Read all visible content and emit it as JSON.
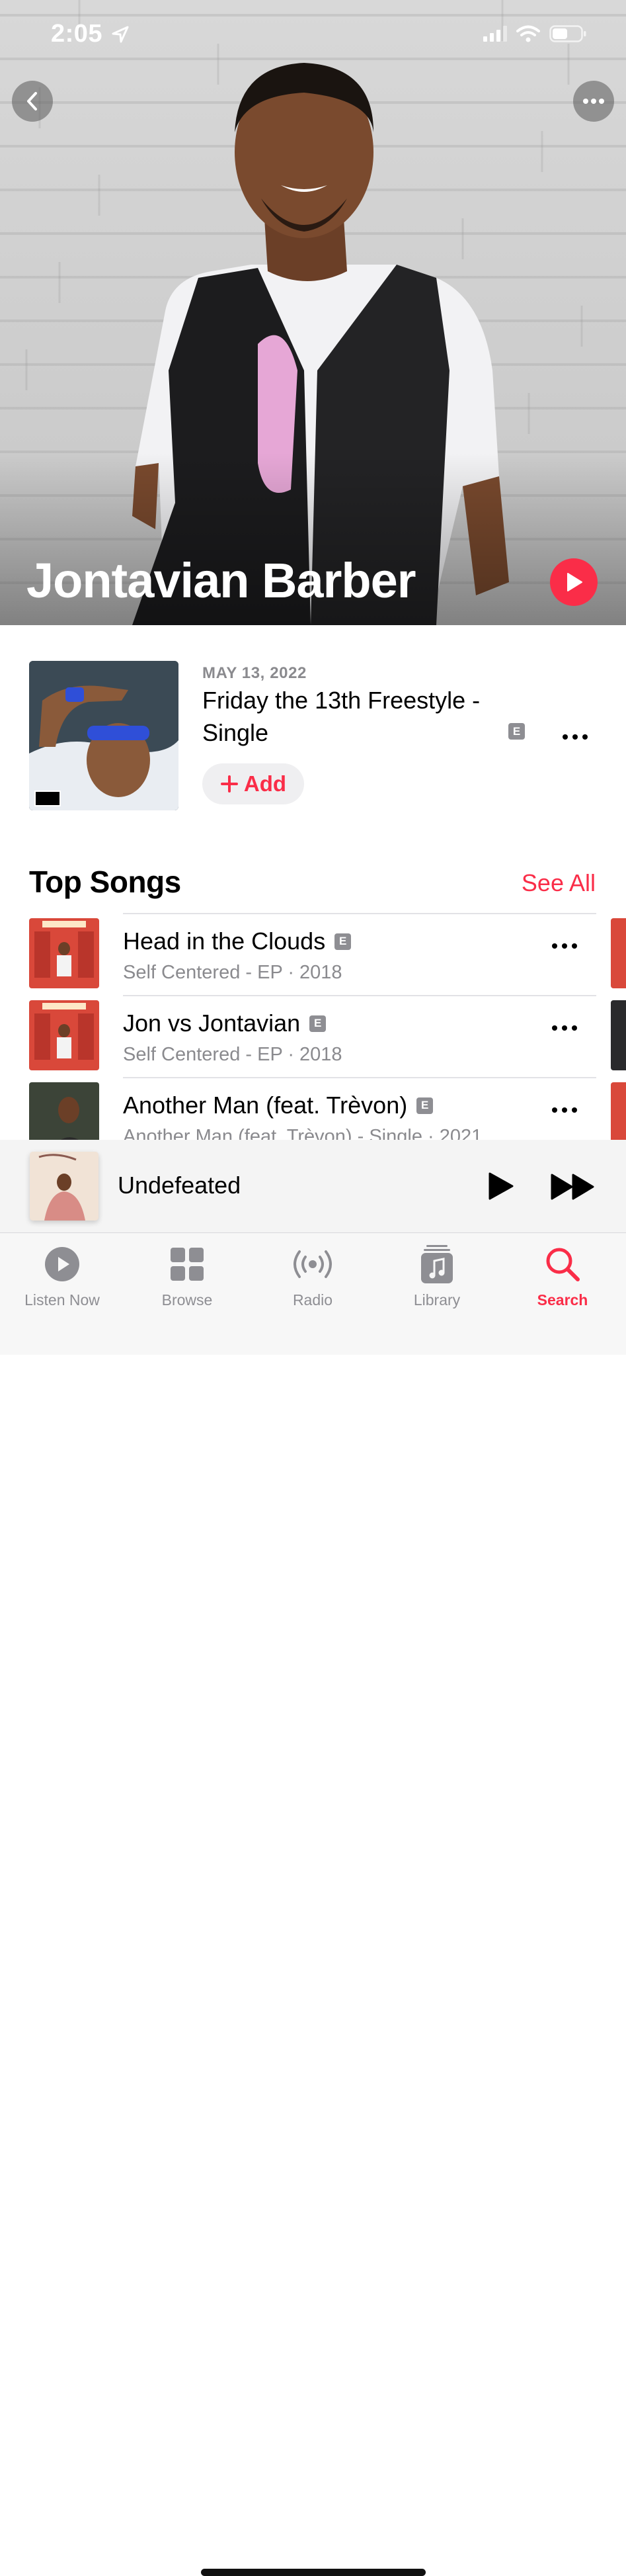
{
  "status_bar": {
    "time": "2:05"
  },
  "artist": {
    "name": "Jontavian Barber"
  },
  "latest_release": {
    "date": "MAY 13, 2022",
    "title": "Friday the 13th Freestyle - Single",
    "explicit": "E",
    "add_label": "Add"
  },
  "top_songs": {
    "heading": "Top Songs",
    "see_all": "See All",
    "items": [
      {
        "title": "Head in the Clouds",
        "explicit": "E",
        "subtitle": "Self Centered - EP · 2018"
      },
      {
        "title": "Jon vs Jontavian",
        "explicit": "E",
        "subtitle": "Self Centered - EP · 2018"
      },
      {
        "title": "Another Man (feat. Trèvon)",
        "explicit": "E",
        "subtitle": "Another Man (feat. Trèvon) - Single · 2021"
      }
    ]
  },
  "now_playing": {
    "title": "Undefeated"
  },
  "tabs": [
    {
      "label": "Listen Now",
      "icon": "play-circle-icon"
    },
    {
      "label": "Browse",
      "icon": "grid-icon"
    },
    {
      "label": "Radio",
      "icon": "radio-waves-icon"
    },
    {
      "label": "Library",
      "icon": "music-note-stack-icon"
    },
    {
      "label": "Search",
      "icon": "search-icon",
      "active": true
    }
  ],
  "colors": {
    "accent": "#fa2d48",
    "secondary_text": "#8a8a8e"
  }
}
